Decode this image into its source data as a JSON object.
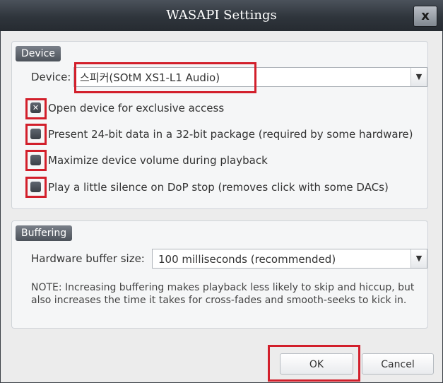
{
  "window": {
    "title": "WASAPI Settings",
    "close_glyph": "x"
  },
  "device_group": {
    "header": "Device",
    "device_label": "Device:",
    "device_value": "스피커(SOtM XS1-L1 Audio)",
    "options": [
      {
        "label": "Open device for exclusive access",
        "checked": true
      },
      {
        "label": "Present 24-bit data in a 32-bit package (required by some hardware)",
        "checked": false
      },
      {
        "label": "Maximize device volume during playback",
        "checked": false
      },
      {
        "label": "Play a little silence on DoP stop (removes click with some DACs)",
        "checked": false
      }
    ]
  },
  "buffering_group": {
    "header": "Buffering",
    "buffer_label": "Hardware buffer size:",
    "buffer_value": "100 milliseconds (recommended)",
    "note": "NOTE: Increasing buffering makes playback less likely to skip and hiccup, but also increases the time it takes for cross-fades and smooth-seeks to kick in."
  },
  "buttons": {
    "ok": "OK",
    "cancel": "Cancel"
  },
  "icons": {
    "dropdown": "chevron-down-icon",
    "checkbox_checked": "x-mark-icon",
    "close": "close-icon"
  },
  "colors": {
    "highlight": "#d21f2b",
    "titlebar": "#2f353c"
  }
}
